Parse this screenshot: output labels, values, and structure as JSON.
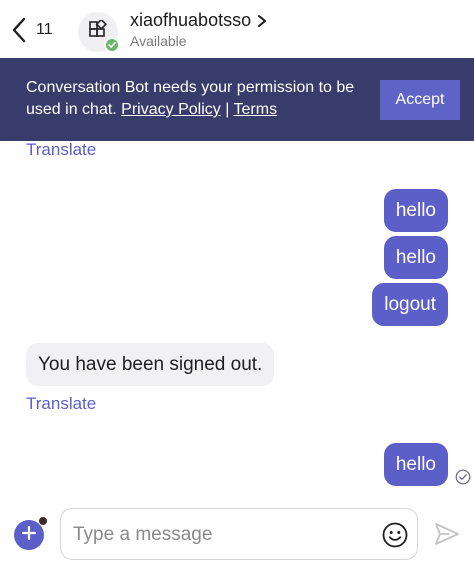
{
  "header": {
    "back_count": "11",
    "title": "xiaofhuabotsso",
    "status": "Available",
    "title_chevron": ">"
  },
  "banner": {
    "text_prefix": "Conversation Bot needs your permission to be used in chat. ",
    "privacy_label": "Privacy Policy",
    "separator": " | ",
    "terms_label": "Terms",
    "accept_label": "Accept"
  },
  "messages": {
    "translate_top": "Translate",
    "out_1": "hello",
    "out_2": "hello",
    "out_3": "logout",
    "in_1": "You have been signed out.",
    "translate_bottom": "Translate",
    "out_4": "hello"
  },
  "composer": {
    "placeholder": "Type a message"
  },
  "colors": {
    "accent": "#5b5fc7",
    "banner_bg": "#383c6b",
    "presence": "#6bb56b"
  },
  "icons": {
    "back": "chevron-left-icon",
    "avatar": "app-grid-icon",
    "presence": "check-icon",
    "add": "plus-icon",
    "emoji": "emoji-icon",
    "send": "send-icon",
    "read": "read-receipt-icon"
  }
}
